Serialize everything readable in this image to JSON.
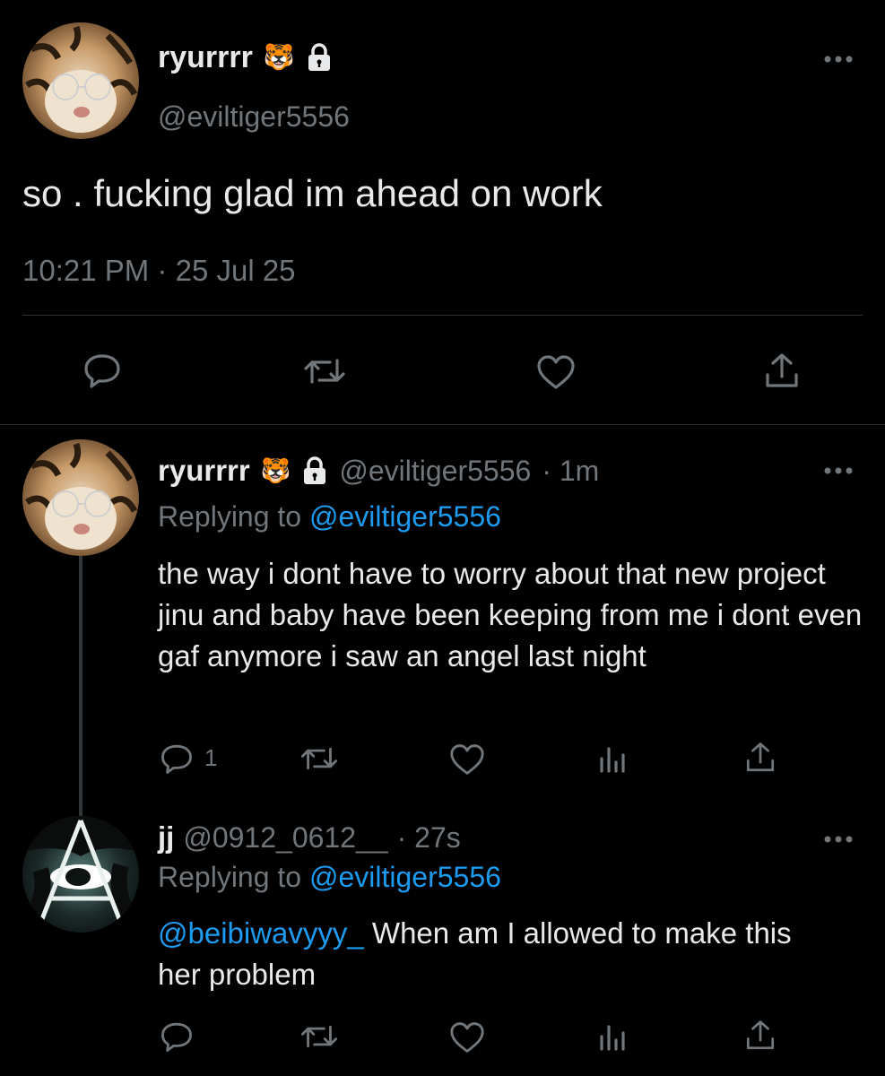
{
  "main_tweet": {
    "display_name": "ryurrrr",
    "name_emoji": "🐯",
    "handle": "@eviltiger5556",
    "text": "so . fucking glad im ahead on work",
    "time": "10:21 PM",
    "separator": "·",
    "date": "25 Jul 25"
  },
  "reply1": {
    "display_name": "ryurrrr",
    "name_emoji": "🐯",
    "handle": "@eviltiger5556",
    "age": "· 1m",
    "replying_prefix": "Replying to",
    "replying_handle": "@eviltiger5556",
    "text": "the way i dont have to worry about that new project jinu and baby have been keeping from me i dont even gaf anymore i saw an angel last night",
    "reply_count": "1"
  },
  "reply2": {
    "display_name": "jj",
    "handle": "@0912_0612__",
    "age": "· 27s",
    "replying_prefix": "Replying to",
    "replying_handle": "@eviltiger5556",
    "mention": "@beibiwavyyy_",
    "text": " When am I allowed to make this her problem"
  },
  "colors": {
    "background": "#000000",
    "text": "#e7e9ea",
    "muted": "#71767b",
    "link": "#1d9bf0",
    "divider": "#2f3336"
  }
}
